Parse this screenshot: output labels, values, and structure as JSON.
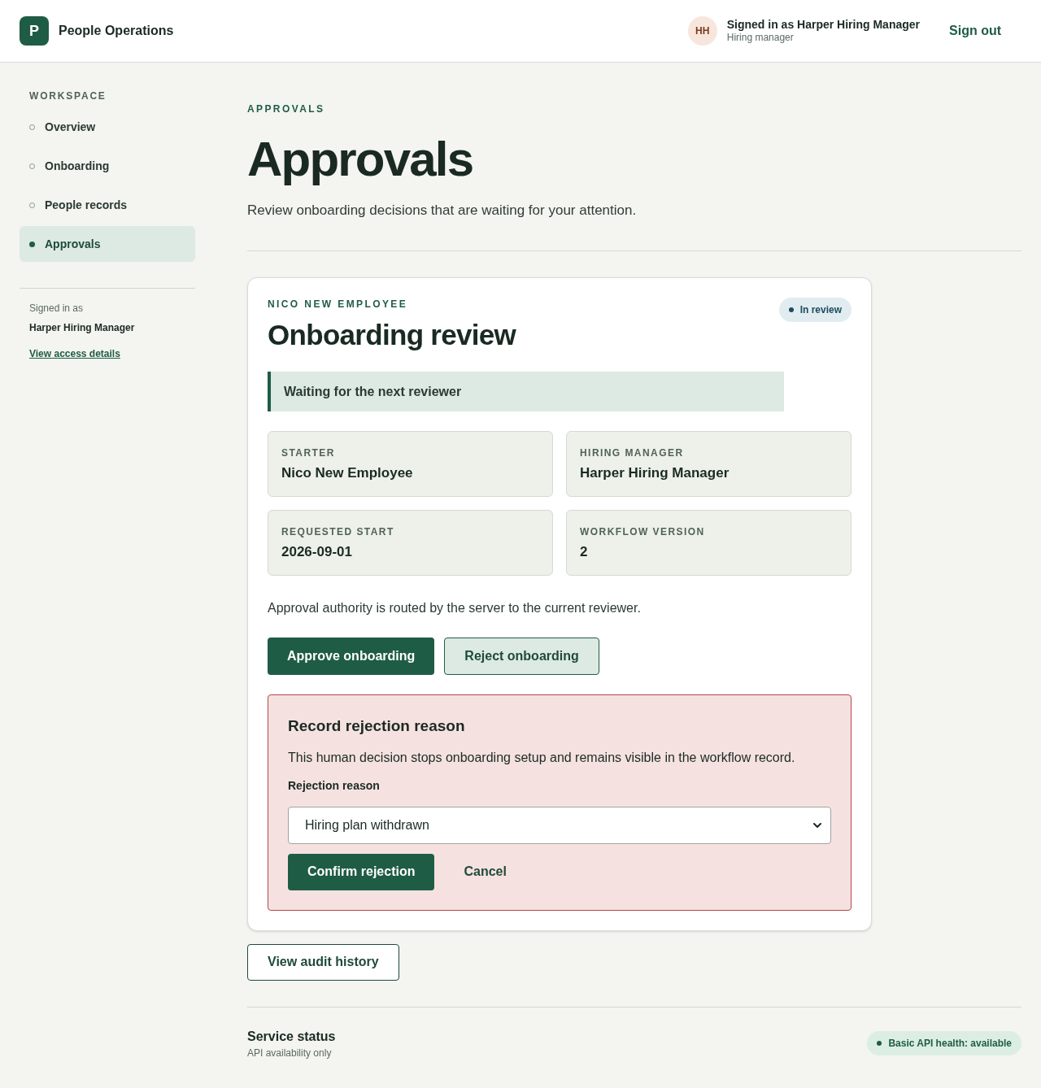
{
  "header": {
    "logo_letter": "P",
    "app_name": "People Operations",
    "avatar_initials": "HH",
    "user_line": "Signed in as Harper Hiring Manager",
    "user_role": "Hiring manager",
    "sign_out": "Sign out"
  },
  "sidebar": {
    "heading": "WORKSPACE",
    "items": [
      {
        "label": "Overview",
        "selected": false
      },
      {
        "label": "Onboarding",
        "selected": false
      },
      {
        "label": "People records",
        "selected": false
      },
      {
        "label": "Approvals",
        "selected": true
      }
    ],
    "signed_in_label": "Signed in as",
    "signed_in_name": "Harper Hiring Manager",
    "access_link": "View access details"
  },
  "page": {
    "eyebrow": "APPROVALS",
    "title": "Approvals",
    "subtitle": "Review onboarding decisions that are waiting for your attention."
  },
  "card": {
    "eyebrow": "NICO NEW EMPLOYEE",
    "title": "Onboarding review",
    "status": "In review",
    "notice": "Waiting for the next reviewer",
    "fields": [
      {
        "label": "STARTER",
        "value": "Nico New Employee"
      },
      {
        "label": "HIRING MANAGER",
        "value": "Harper Hiring Manager"
      },
      {
        "label": "REQUESTED START",
        "value": "2026-09-01"
      },
      {
        "label": "WORKFLOW VERSION",
        "value": "2"
      }
    ],
    "routing_note": "Approval authority is routed by the server to the current reviewer.",
    "approve_button": "Approve onboarding",
    "reject_button": "Reject onboarding",
    "rejection": {
      "title": "Record rejection reason",
      "description": "This human decision stops onboarding setup and remains visible in the workflow record.",
      "field_label": "Rejection reason",
      "value": "Hiring plan withdrawn",
      "confirm_button": "Confirm rejection",
      "cancel_button": "Cancel"
    }
  },
  "audit_button": "View audit history",
  "footer": {
    "title": "Service status",
    "subtitle": "API availability only",
    "health": "Basic API health: available"
  }
}
